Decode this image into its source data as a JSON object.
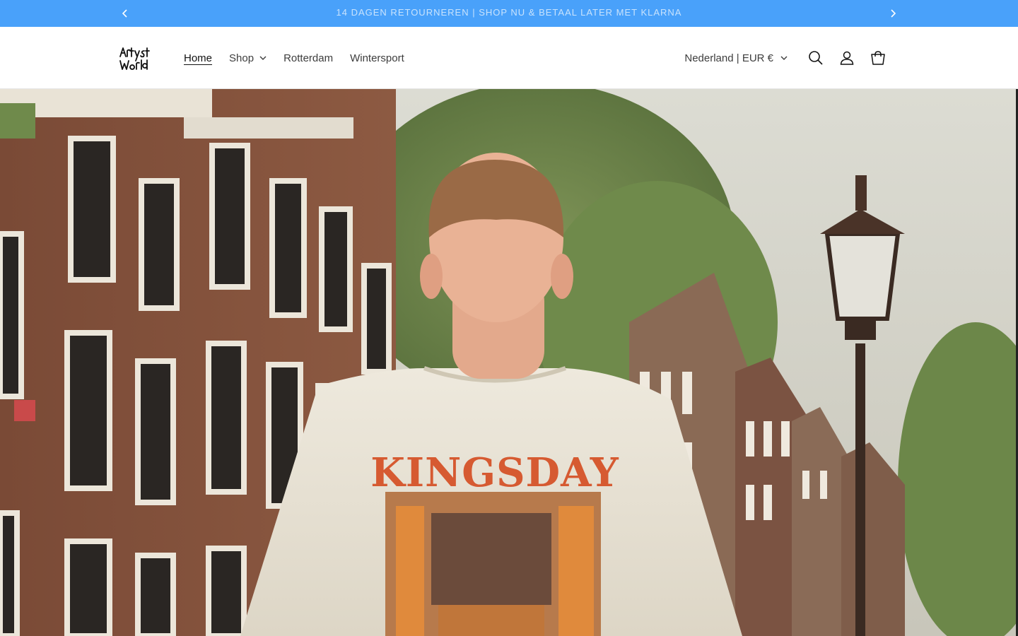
{
  "announcement": {
    "text": "14 DAGEN RETOURNEREN | SHOP NU & BETAAL LATER MET KLARNA",
    "prev_icon": "chevron-left-icon",
    "next_icon": "chevron-right-icon",
    "background": "#49a1fa"
  },
  "header": {
    "logo_text": "Artyst World",
    "nav": [
      {
        "label": "Home",
        "active": true
      },
      {
        "label": "Shop",
        "has_dropdown": true
      },
      {
        "label": "Rotterdam"
      },
      {
        "label": "Wintersport"
      }
    ],
    "country_selector": "Nederland | EUR €",
    "icons": [
      "search-icon",
      "account-icon",
      "cart-icon"
    ]
  },
  "hero": {
    "shirt_print_title": "KINGSDAY",
    "accent_color": "#d65a31"
  }
}
